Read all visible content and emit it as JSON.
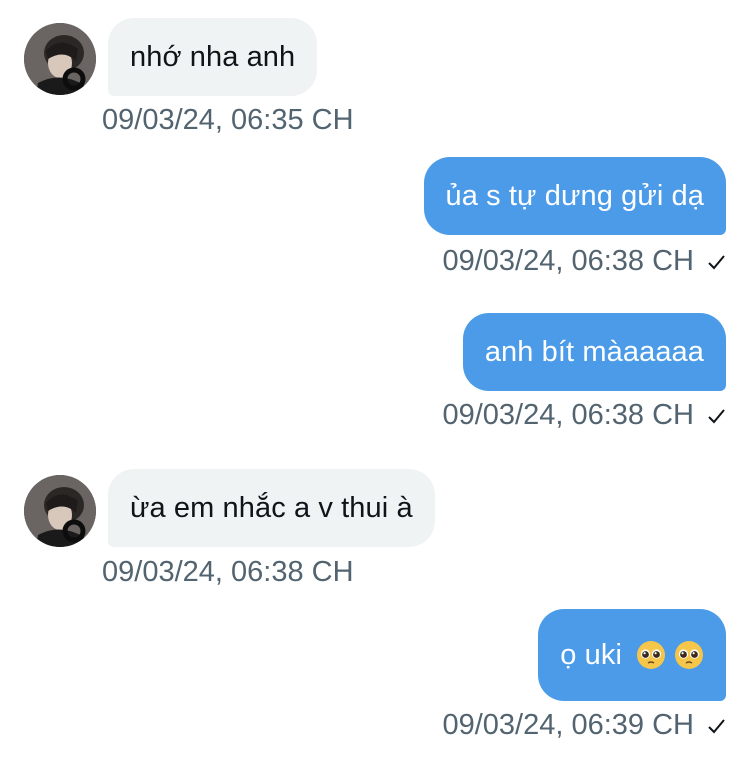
{
  "messages": [
    {
      "direction": "in",
      "text": "nhớ nha anh",
      "timestamp": "09/03/24, 06:35 CH",
      "seen": false
    },
    {
      "direction": "out",
      "text": "ủa s tự dưng gửi dạ",
      "timestamp": "09/03/24, 06:38 CH",
      "seen": true
    },
    {
      "direction": "out",
      "text": "anh bít màaaaaa",
      "timestamp": "09/03/24, 06:38 CH",
      "seen": true
    },
    {
      "direction": "in",
      "text": "ừa em nhắc a v thui à",
      "timestamp": "09/03/24, 06:38 CH",
      "seen": false
    },
    {
      "direction": "out",
      "text": "ọ uki",
      "emojis": [
        "pleading-face-emoji",
        "pleading-face-emoji"
      ],
      "timestamp": "09/03/24, 06:39 CH",
      "seen": true
    }
  ],
  "icons": {
    "seen": "checkmark-icon",
    "avatar": "contact-avatar"
  },
  "colors": {
    "incoming_bubble": "#eff3f4",
    "outgoing_bubble": "#4b9be8",
    "timestamp": "#536471",
    "text": "#0f1419"
  }
}
